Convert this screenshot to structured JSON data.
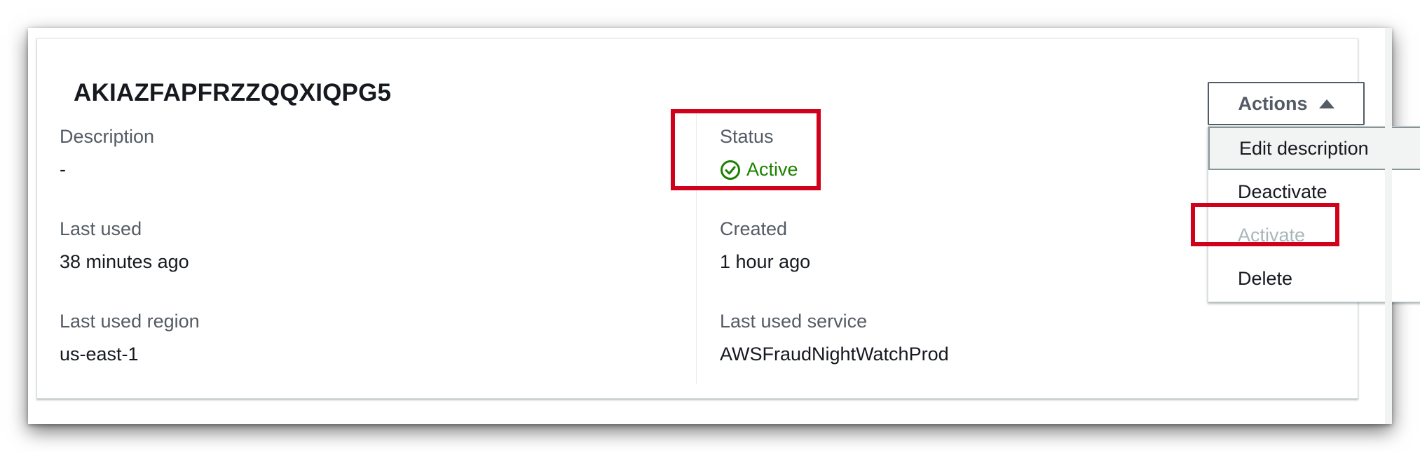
{
  "key": {
    "id": "AKIAZFAPFRZZQQXIQPG5"
  },
  "fields": {
    "description_label": "Description",
    "description_value": "-",
    "status_label": "Status",
    "status_value": "Active",
    "last_used_label": "Last used",
    "last_used_value": "38 minutes ago",
    "created_label": "Created",
    "created_value": "1 hour ago",
    "last_used_region_label": "Last used region",
    "last_used_region_value": "us-east-1",
    "last_used_service_label": "Last used service",
    "last_used_service_value": "AWSFraudNightWatchProd"
  },
  "actions": {
    "button_label": "Actions",
    "menu": {
      "edit_description": "Edit description",
      "deactivate": "Deactivate",
      "activate": "Activate",
      "delete": "Delete"
    }
  },
  "icons": {
    "status": "check-circle-icon",
    "dropdown": "caret-up-icon"
  },
  "colors": {
    "status_active": "#1d8102",
    "highlight": "#d0021b",
    "disabled_text": "#aab7b8"
  }
}
